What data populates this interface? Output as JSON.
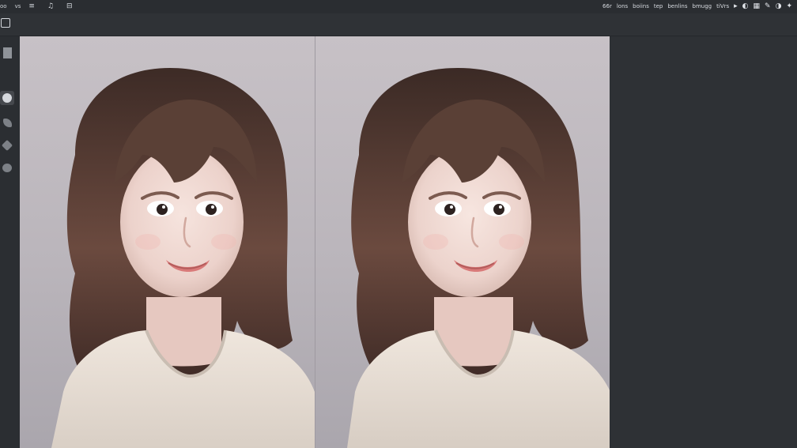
{
  "menubar": {
    "left_items": [
      "oo",
      "vs"
    ],
    "left_glyphs": [
      "≡",
      "♫",
      "⊟"
    ],
    "right_items": [
      "66r",
      "lons",
      "boiins",
      "tep",
      "benlins",
      "bmugg",
      "tiVrs"
    ],
    "right_icons": [
      "cursor-icon",
      "mode-icon",
      "layers-icon",
      "brush-icon",
      "toggle-icon",
      "settings-icon"
    ]
  },
  "toolbar": {
    "tools": [
      "square-tool",
      "brush-tool",
      "leaf-tool",
      "diamond-tool",
      "blob-tool"
    ]
  },
  "canvas": {
    "images": [
      "portrait-left",
      "portrait-right"
    ]
  },
  "colors": {
    "hair": "#5a4036",
    "skin": "#f0d6cf",
    "sweater": "#e8ddd3",
    "background": "#c3bec4"
  }
}
